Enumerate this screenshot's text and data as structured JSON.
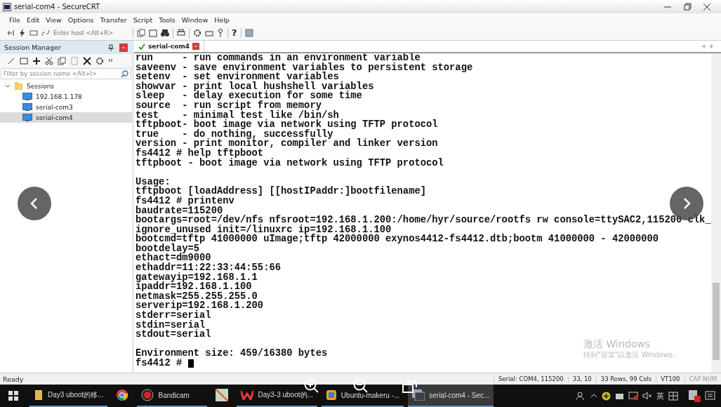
{
  "window": {
    "title": "serial-com4 - SecureCRT"
  },
  "menu": [
    "File",
    "Edit",
    "View",
    "Options",
    "Transfer",
    "Script",
    "Tools",
    "Window",
    "Help"
  ],
  "toolbar": {
    "host_placeholder": "Enter host <Alt+R>",
    "help": "?"
  },
  "session_manager": {
    "title": "Session Manager",
    "filter_placeholder": "Filter by session name <Alt+I>",
    "tree": [
      {
        "label": "Sessions",
        "kind": "folder",
        "expanded": true,
        "selected": false,
        "children": [
          {
            "label": "192.168.1.178",
            "kind": "session",
            "selected": false
          },
          {
            "label": "serial-com3",
            "kind": "session",
            "selected": false
          },
          {
            "label": "serial-com4",
            "kind": "session",
            "selected": true
          }
        ]
      }
    ]
  },
  "tabs": [
    {
      "label": "serial-com4",
      "selected": true,
      "connected": true
    }
  ],
  "terminal": {
    "blocks": [
      [
        "run     - run commands in an environment variable",
        "saveenv - save environment variables to persistent storage",
        "setenv  - set environment variables",
        "showvar - print local hushshell variables",
        "sleep   - delay execution for some time",
        "source  - run script from memory",
        "test    - minimal test like /bin/sh",
        "tftpboot- boot image via network using TFTP protocol",
        "true    - do nothing, successfully",
        "version - print monitor, compiler and linker version",
        "fs4412 # help tftpboot",
        "tftpboot - boot image via network using TFTP protocol"
      ],
      [
        "Usage:",
        "tftpboot [loadAddress] [[hostIPaddr:]bootfilename]",
        "fs4412 # printenv",
        "baudrate=115200",
        "bootargs=root=/dev/nfs nfsroot=192.168.1.200:/home/hyr/source/rootfs rw console=ttySAC2,115200 clk_",
        "ignore_unused init=/linuxrc ip=192.168.1.100",
        "bootcmd=tftp 41000000 uImage;tftp 42000000 exynos4412-fs4412.dtb;bootm 41000000 - 42000000",
        "bootdelay=5",
        "ethact=dm9000",
        "ethaddr=11:22:33:44:55:66",
        "gatewayip=192.168.1.1",
        "ipaddr=192.168.1.100",
        "netmask=255.255.255.0",
        "serverip=192.168.1.200",
        "stderr=serial",
        "stdin=serial",
        "stdout=serial"
      ],
      [
        "Environment size: 459/16380 bytes",
        "fs4412 # "
      ]
    ]
  },
  "activation": {
    "title": "激活 Windows",
    "hint": "转到\"设置\"以激活 Windows。"
  },
  "status_bar": {
    "left": "Ready",
    "fields": [
      "Serial: COM4, 115200",
      "33,  10",
      "33 Rows, 99 Cols",
      "VT100",
      "CAP  NUM"
    ]
  },
  "taskbar": {
    "items": [
      {
        "label": "Day3 uboot的移...",
        "kind": "folder",
        "active": false
      },
      {
        "kind": "chrome",
        "active": false
      },
      {
        "label": "Bandicam",
        "kind": "record",
        "active": false
      },
      {
        "kind": "map",
        "active": false
      },
      {
        "label": "Day3-3 uboot的...",
        "kind": "wps",
        "active": false
      },
      {
        "label": "Ubuntu-makeru -...",
        "kind": "vm",
        "active": false
      },
      {
        "label": "serial-com4 - Sec...",
        "kind": "crt",
        "active": true
      }
    ],
    "ime": "英"
  }
}
